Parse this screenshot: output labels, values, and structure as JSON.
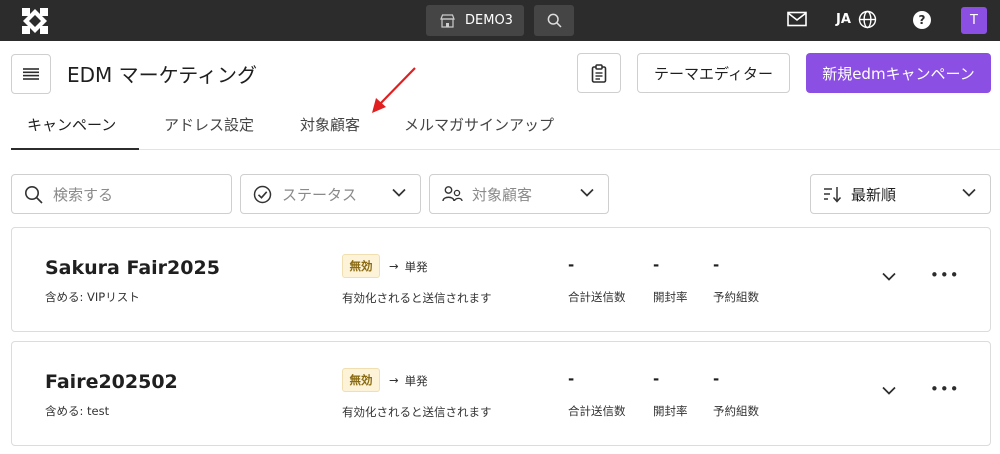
{
  "topbar": {
    "store_label": "DEMO3",
    "language": "JA",
    "help_glyph": "?",
    "avatar_initial": "T"
  },
  "header": {
    "title": "EDM マーケティング",
    "theme_editor_label": "テーマエディター",
    "new_campaign_label": "新規edmキャンペーン"
  },
  "tabs": [
    {
      "label": "キャンペーン",
      "active": true
    },
    {
      "label": "アドレス設定",
      "active": false
    },
    {
      "label": "対象顧客",
      "active": false
    },
    {
      "label": "メルマガサインアップ",
      "active": false
    }
  ],
  "filters": {
    "search_placeholder": "検索する",
    "status_label": "ステータス",
    "audience_label": "対象顧客",
    "sort_label": "最新順"
  },
  "campaigns": [
    {
      "name": "Sakura Fair2025",
      "include": "含める: VIPリスト",
      "status": "無効",
      "arrow": "→",
      "schedule": "単発",
      "note": "有効化されると送信されます",
      "metrics": [
        {
          "value": "-",
          "label": "合計送信数"
        },
        {
          "value": "-",
          "label": "開封率"
        },
        {
          "value": "-",
          "label": "予約組数"
        }
      ]
    },
    {
      "name": "Faire202502",
      "include": "含める: test",
      "status": "無効",
      "arrow": "→",
      "schedule": "単発",
      "note": "有効化されると送信されます",
      "metrics": [
        {
          "value": "-",
          "label": "合計送信数"
        },
        {
          "value": "-",
          "label": "開封率"
        },
        {
          "value": "-",
          "label": "予約組数"
        }
      ]
    }
  ],
  "more_glyph": "•••",
  "colors": {
    "topbar": "#2c2c2c",
    "accent": "#8b4fe4",
    "badge_bg": "#fdf3d8",
    "annotation_arrow": "#e02020"
  }
}
